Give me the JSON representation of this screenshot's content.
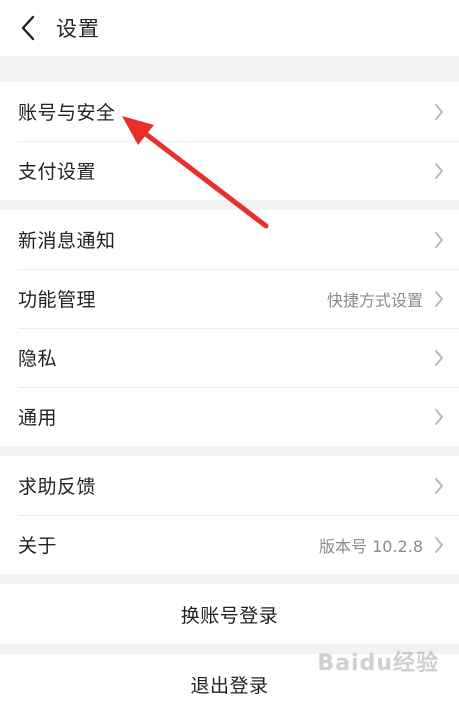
{
  "header": {
    "title": "设置",
    "back_icon": "chevron-left-icon"
  },
  "groups": [
    [
      {
        "label": "账号与安全",
        "value": ""
      },
      {
        "label": "支付设置",
        "value": ""
      }
    ],
    [
      {
        "label": "新消息通知",
        "value": ""
      },
      {
        "label": "功能管理",
        "value": "快捷方式设置"
      },
      {
        "label": "隐私",
        "value": ""
      },
      {
        "label": "通用",
        "value": ""
      }
    ],
    [
      {
        "label": "求助反馈",
        "value": ""
      },
      {
        "label": "关于",
        "value": "版本号 10.2.8"
      }
    ]
  ],
  "actions": {
    "switch_account": "换账号登录",
    "logout": "退出登录"
  },
  "colors": {
    "background": "#f2f2f2",
    "surface": "#ffffff",
    "text": "#222222",
    "secondary_text": "#8c8c8c",
    "chevron": "#b5b5b5",
    "annotation": "#e8302c"
  },
  "watermark": "Baidu经验"
}
